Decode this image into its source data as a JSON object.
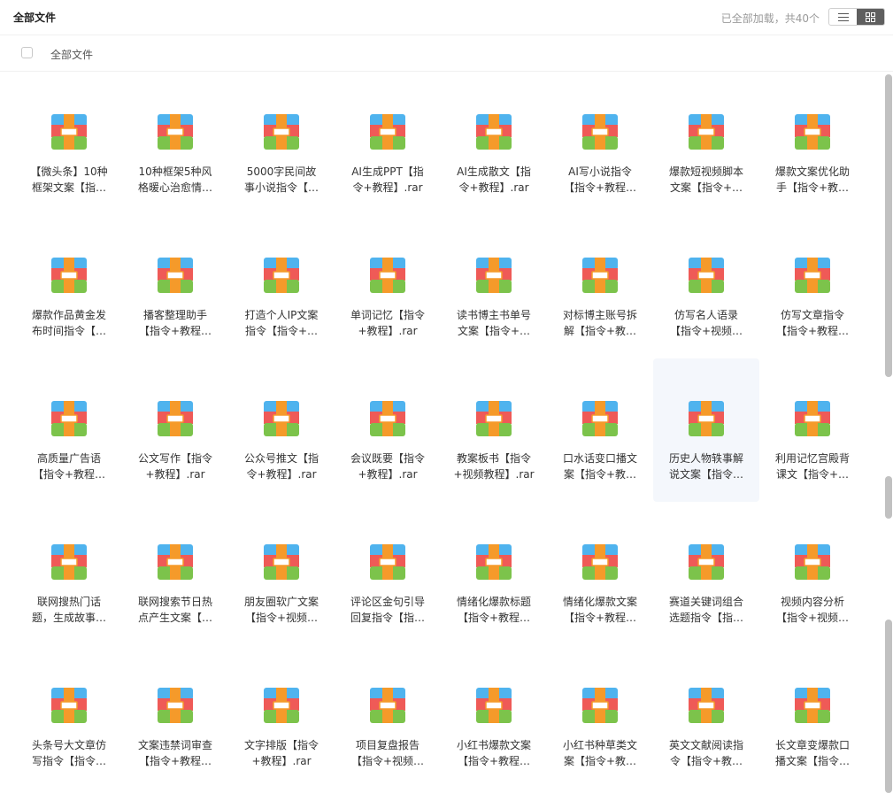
{
  "header": {
    "title": "全部文件",
    "load_status": "已全部加载，共40个",
    "view_list_icon": "list-view-icon",
    "view_grid_icon": "grid-view-icon"
  },
  "toolbar": {
    "select_all_label": "全部文件"
  },
  "icon": "archive-file-icon",
  "files": [
    {
      "line1": "【微头条】10种",
      "line2": "框架文案【指…"
    },
    {
      "line1": "10种框架5种风",
      "line2": "格暖心治愈情…"
    },
    {
      "line1": "5000字民间故",
      "line2": "事小说指令【…"
    },
    {
      "line1": "AI生成PPT【指",
      "line2": "令+教程】.rar"
    },
    {
      "line1": "AI生成散文【指",
      "line2": "令+教程】.rar"
    },
    {
      "line1": "AI写小说指令",
      "line2": "【指令+教程…"
    },
    {
      "line1": "爆款短视频脚本",
      "line2": "文案【指令+…"
    },
    {
      "line1": "爆款文案优化助",
      "line2": "手【指令+教…"
    },
    {
      "line1": "爆款作品黄金发",
      "line2": "布时间指令【…"
    },
    {
      "line1": "播客整理助手",
      "line2": "【指令+教程…"
    },
    {
      "line1": "打造个人IP文案",
      "line2": "指令【指令+…"
    },
    {
      "line1": "单词记忆【指令",
      "line2": "+教程】.rar"
    },
    {
      "line1": "读书博主书单号",
      "line2": "文案【指令+…"
    },
    {
      "line1": "对标博主账号拆",
      "line2": "解【指令+教…"
    },
    {
      "line1": "仿写名人语录",
      "line2": "【指令+视频…"
    },
    {
      "line1": "仿写文章指令",
      "line2": "【指令+教程…"
    },
    {
      "line1": "高质量广告语",
      "line2": "【指令+教程…"
    },
    {
      "line1": "公文写作【指令",
      "line2": "+教程】.rar"
    },
    {
      "line1": "公众号推文【指",
      "line2": "令+教程】.rar"
    },
    {
      "line1": "会议既要【指令",
      "line2": "+教程】.rar"
    },
    {
      "line1": "教案板书【指令",
      "line2": "+视频教程】.rar"
    },
    {
      "line1": "口水话变口播文",
      "line2": "案【指令+教…"
    },
    {
      "line1": "历史人物轶事解",
      "line2": "说文案【指令…"
    },
    {
      "line1": "利用记忆宫殿背",
      "line2": "课文【指令+…"
    },
    {
      "line1": "联网搜热门话",
      "line2": "题，生成故事…"
    },
    {
      "line1": "联网搜索节日热",
      "line2": "点产生文案【…"
    },
    {
      "line1": "朋友圈软广文案",
      "line2": "【指令+视频…"
    },
    {
      "line1": "评论区金句引导",
      "line2": "回复指令【指…"
    },
    {
      "line1": "情绪化爆款标题",
      "line2": "【指令+教程…"
    },
    {
      "line1": "情绪化爆款文案",
      "line2": "【指令+教程…"
    },
    {
      "line1": "赛道关键词组合",
      "line2": "选题指令【指…"
    },
    {
      "line1": "视频内容分析",
      "line2": "【指令+视频…"
    },
    {
      "line1": "头条号大文章仿",
      "line2": "写指令【指令…"
    },
    {
      "line1": "文案违禁词审查",
      "line2": "【指令+教程…"
    },
    {
      "line1": "文字排版【指令",
      "line2": "+教程】.rar"
    },
    {
      "line1": "项目复盘报告",
      "line2": "【指令+视频…"
    },
    {
      "line1": "小红书爆款文案",
      "line2": "【指令+教程…"
    },
    {
      "line1": "小红书种草类文",
      "line2": "案【指令+教…"
    },
    {
      "line1": "英文文献阅读指",
      "line2": "令【指令+教…"
    },
    {
      "line1": "长文章变爆款口",
      "line2": "播文案【指令…"
    }
  ]
}
